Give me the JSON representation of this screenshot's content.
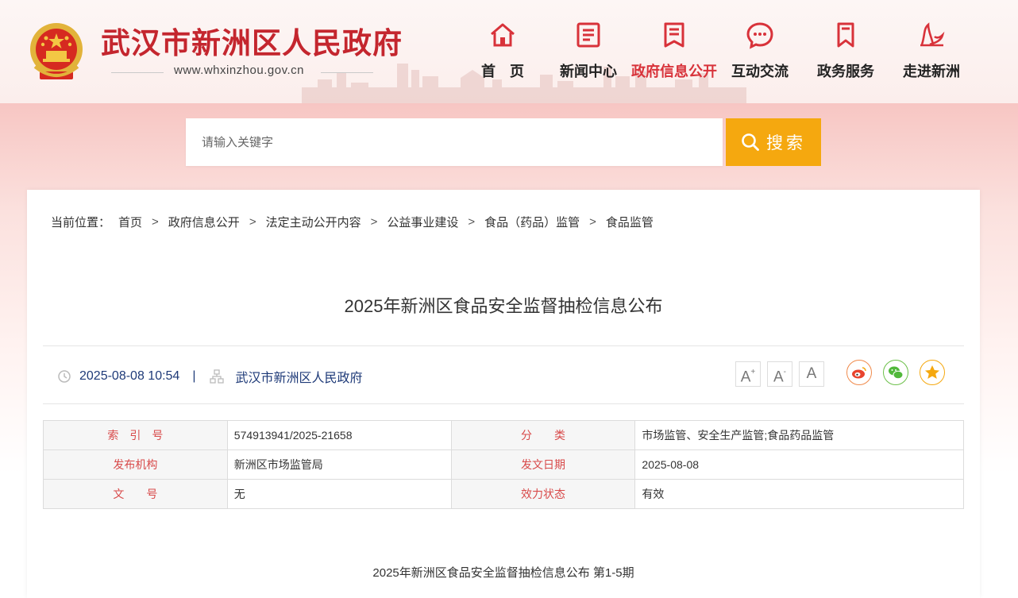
{
  "header": {
    "site_title": "武汉市新洲区人民政府",
    "site_url": "www.whxinzhou.gov.cn"
  },
  "nav": {
    "items": [
      {
        "label": "首　页",
        "icon": "home-icon",
        "active": false
      },
      {
        "label": "新闻中心",
        "icon": "news-icon",
        "active": false
      },
      {
        "label": "政府信息公开",
        "icon": "info-disclosure-icon",
        "active": true
      },
      {
        "label": "互动交流",
        "icon": "chat-icon",
        "active": false
      },
      {
        "label": "政务服务",
        "icon": "bookmark-icon",
        "active": false
      },
      {
        "label": "走进新洲",
        "icon": "xinzhou-icon",
        "active": false
      }
    ]
  },
  "search": {
    "placeholder": "请输入关键字",
    "button_label": "搜索"
  },
  "breadcrumb": {
    "prefix": "当前位置：",
    "items": [
      "首页",
      "政府信息公开",
      "法定主动公开内容",
      "公益事业建设",
      "食品（药品）监管",
      "食品监管"
    ],
    "separator": ">"
  },
  "article": {
    "title": "2025年新洲区食品安全监督抽检信息公布",
    "date": "2025-08-08 10:54",
    "divider": "|",
    "source": "武汉市新洲区人民政府",
    "sub_title": "2025年新洲区食品安全监督抽检信息公布 第1-5期"
  },
  "font_controls": {
    "larger": "A",
    "smaller": "A",
    "default": "A",
    "larger_mark": "+",
    "smaller_mark": "-"
  },
  "share": [
    "weibo-icon",
    "wechat-icon",
    "favorite-icon"
  ],
  "info_table": {
    "rows": [
      {
        "k1": "索　引　号",
        "v1": "574913941/2025-21658",
        "k2": "分　　类",
        "v2": "市场监管、安全生产监管;食品药品监管"
      },
      {
        "k1": "发布机构",
        "v1": "新洲区市场监管局",
        "k2": "发文日期",
        "v2": "2025-08-08"
      },
      {
        "k1": "文　　号",
        "v1": "无",
        "k2": "效力状态",
        "v2": "有效"
      }
    ]
  },
  "colors": {
    "brand_red": "#c4262e",
    "active_nav": "#d8323a",
    "search_orange": "#f5a80f",
    "meta_blue": "#1e3a78",
    "table_key_red": "#d84a4a"
  }
}
